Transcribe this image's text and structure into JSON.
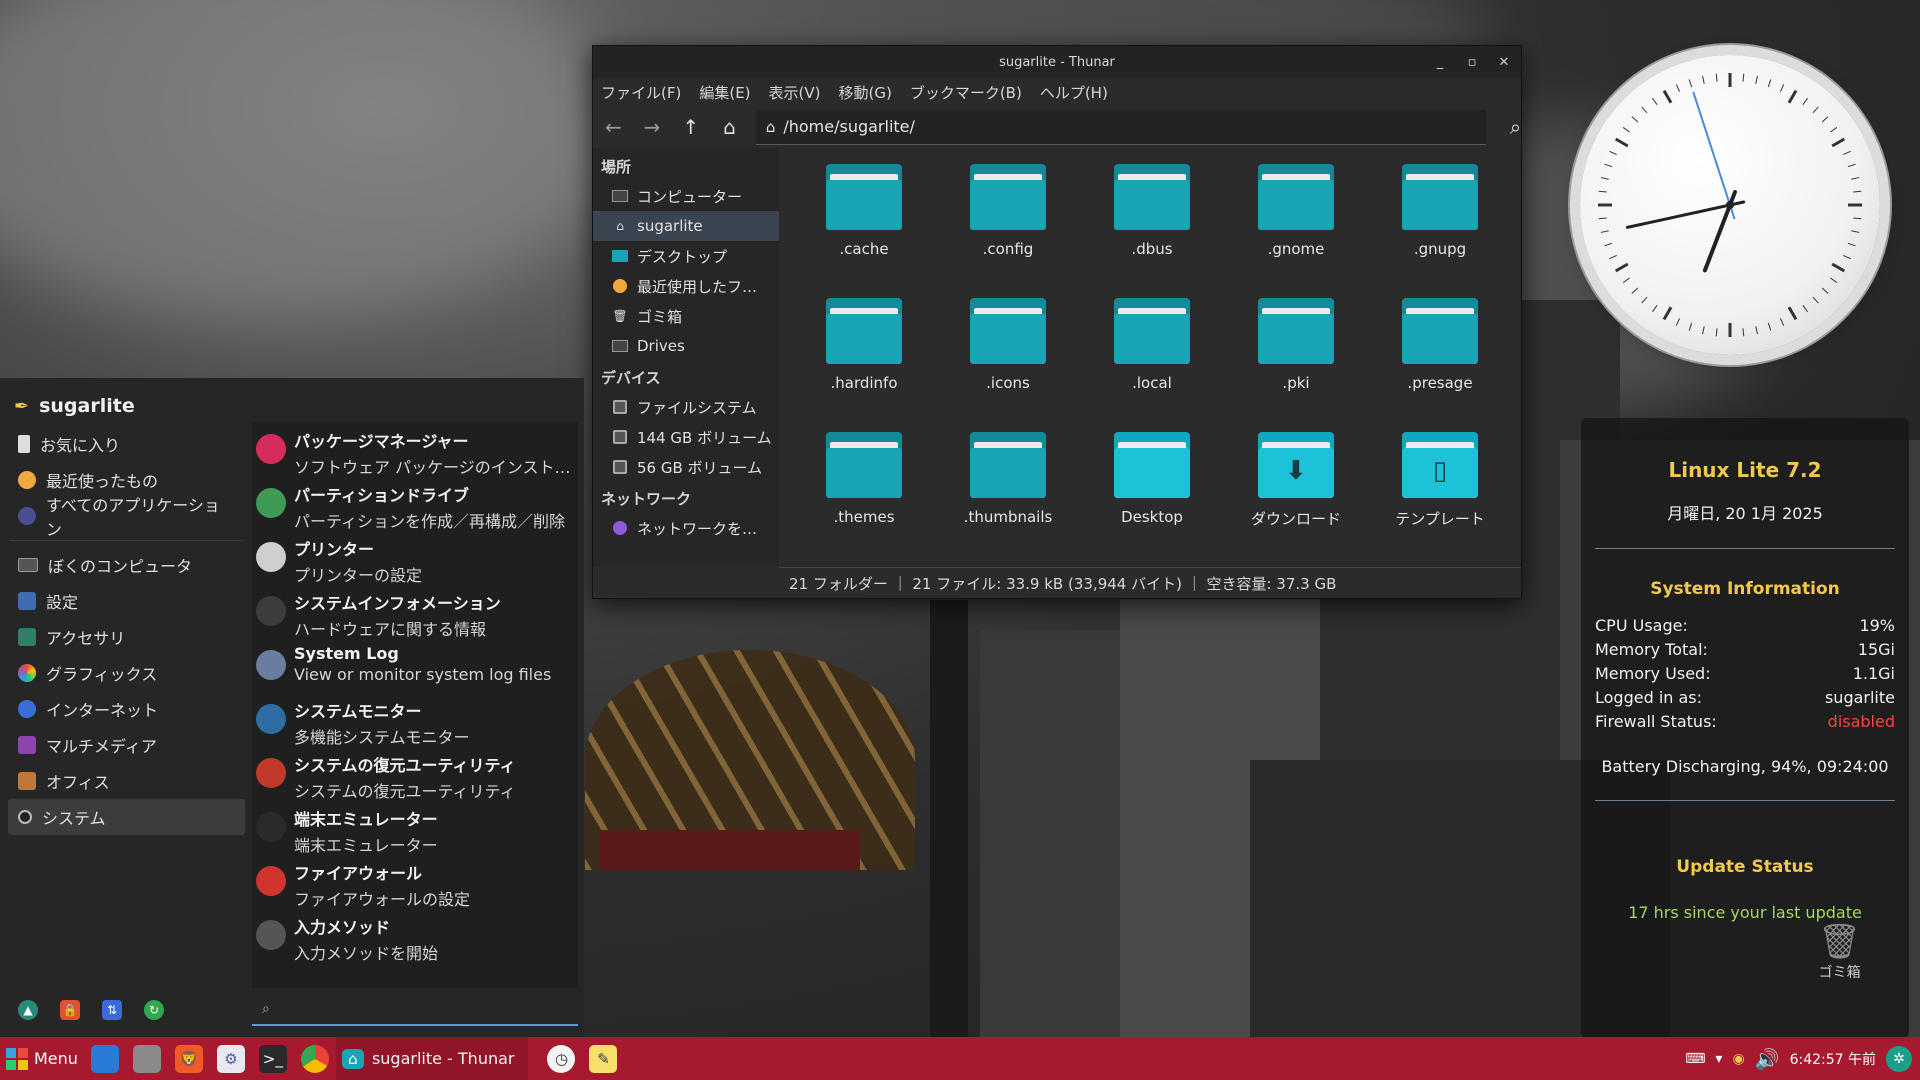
{
  "colors": {
    "taskbar": "#a6192e",
    "folder": "#17a4b4",
    "accent_yellow": "#f2c94c",
    "update_green": "#a3d95c",
    "firewall_red": "#ff4444"
  },
  "thunar": {
    "title": "sugarlite - Thunar",
    "menu": [
      "ファイル(F)",
      "編集(E)",
      "表示(V)",
      "移動(G)",
      "ブックマーク(B)",
      "ヘルプ(H)"
    ],
    "path": "/home/sugarlite/",
    "sidebar": {
      "places_heading": "場所",
      "places": [
        {
          "label": "コンピューター",
          "icon": "computer-icon"
        },
        {
          "label": "sugarlite",
          "icon": "home-icon"
        },
        {
          "label": "デスクトップ",
          "icon": "desktop-icon"
        },
        {
          "label": "最近使用したフ…",
          "icon": "recent-icon"
        },
        {
          "label": "ゴミ箱",
          "icon": "trash-icon"
        },
        {
          "label": "Drives",
          "icon": "drive-icon"
        }
      ],
      "devices_heading": "デバイス",
      "devices": [
        {
          "label": "ファイルシステム",
          "icon": "drive-icon"
        },
        {
          "label": "144 GB ボリューム",
          "icon": "drive-icon"
        },
        {
          "label": "56 GB ボリューム",
          "icon": "drive-icon"
        }
      ],
      "network_heading": "ネットワーク",
      "network": [
        {
          "label": "ネットワークを…",
          "icon": "network-icon"
        }
      ]
    },
    "files": [
      ".cache",
      ".config",
      ".dbus",
      ".gnome",
      ".gnupg",
      ".hardinfo",
      ".icons",
      ".local",
      ".pki",
      ".presage",
      ".themes",
      ".thumbnails",
      "Desktop",
      "ダウンロード",
      "テンプレート"
    ],
    "status": "21 フォルダー ｜ 21 ファイル: 33.9 kB (33,944 バイト) ｜ 空き容量: 37.3 GB"
  },
  "start_menu": {
    "user": "sugarlite",
    "top_categories": [
      {
        "label": "お気に入り",
        "icon": "bookmark-icon"
      },
      {
        "label": "最近使ったもの",
        "icon": "recent-icon"
      },
      {
        "label": "すべてのアプリケーション",
        "icon": "apps-icon"
      }
    ],
    "categories": [
      {
        "label": "ぼくのコンピュータ",
        "icon": "computer-icon"
      },
      {
        "label": "設定",
        "icon": "settings-icon"
      },
      {
        "label": "アクセサリ",
        "icon": "accessories-icon"
      },
      {
        "label": "グラフィックス",
        "icon": "graphics-icon"
      },
      {
        "label": "インターネット",
        "icon": "internet-icon"
      },
      {
        "label": "マルチメディア",
        "icon": "multimedia-icon"
      },
      {
        "label": "オフィス",
        "icon": "office-icon"
      },
      {
        "label": "システム",
        "icon": "system-icon"
      }
    ],
    "apps": [
      {
        "title": "パッケージマネージャー",
        "desc": "ソフトウェア パッケージのインストール",
        "icon": "package-icon",
        "color": "#d62c5c"
      },
      {
        "title": "パーティションドライブ",
        "desc": "パーティションを作成／再構成／削除",
        "icon": "partition-icon",
        "color": "#3f9a55"
      },
      {
        "title": "プリンター",
        "desc": "プリンターの設定",
        "icon": "printer-icon",
        "color": "#cfcfcf"
      },
      {
        "title": "システムインフォメーション",
        "desc": "ハードウェアに関する情報",
        "icon": "info-icon",
        "color": "#3c3c3c"
      },
      {
        "title": "System Log",
        "desc": "View or monitor system log files",
        "icon": "log-icon",
        "color": "#6a7ca0"
      },
      {
        "title": "システムモニター",
        "desc": "多機能システムモニター",
        "icon": "monitor-icon",
        "color": "#2d6da3"
      },
      {
        "title": "システムの復元ユーティリティ",
        "desc": "システムの復元ユーティリティ",
        "icon": "restore-icon",
        "color": "#c0392b"
      },
      {
        "title": "端末エミュレーター",
        "desc": "端末エミュレーター",
        "icon": "terminal-icon",
        "color": "#2a2a2a"
      },
      {
        "title": "ファイアウォール",
        "desc": "ファイアウォールの設定",
        "icon": "firewall-icon",
        "color": "#d0342c"
      },
      {
        "title": "入力メソッド",
        "desc": "入力メソッドを開始",
        "icon": "keyboard-icon",
        "color": "#555555"
      }
    ]
  },
  "conky": {
    "title": "Linux Lite 7.2",
    "date": "月曜日, 20 1月 2025",
    "sysinfo_heading": "System Information",
    "rows": [
      {
        "label": "CPU Usage:",
        "value": "19%"
      },
      {
        "label": "Memory Total:",
        "value": "15Gi"
      },
      {
        "label": "Memory Used:",
        "value": "1.1Gi"
      },
      {
        "label": "Logged in as:",
        "value": "sugarlite"
      },
      {
        "label": "Firewall Status:",
        "value": "disabled"
      }
    ],
    "battery": "Battery Discharging, 94%, 09:24:00",
    "update_heading": "Update Status",
    "update_text": "17 hrs since your last update"
  },
  "desktop": {
    "trash_label": "ゴミ箱"
  },
  "clock": {
    "hour": 6,
    "minute": 42,
    "second": 57
  },
  "taskbar": {
    "menu_label": "Menu",
    "task_label": "sugarlite - Thunar",
    "time": "6:42:57 午前"
  }
}
